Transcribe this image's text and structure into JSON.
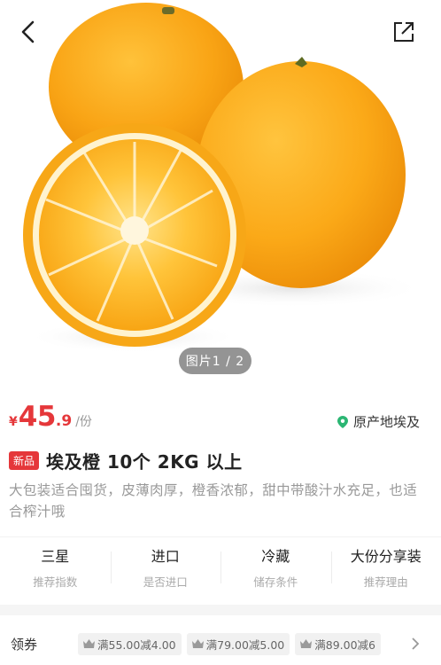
{
  "header": {
    "back_icon": "chevron-left-icon",
    "share_icon": "share-icon"
  },
  "gallery": {
    "counter": "图片1 / 2"
  },
  "price": {
    "symbol": "¥",
    "integer": "45",
    "decimal": ".9",
    "unit": "/份",
    "color": "#e5373a"
  },
  "origin": {
    "label": "原产地埃及",
    "icon": "location-pin-icon",
    "icon_color": "#2bb673"
  },
  "product": {
    "badge": "新品",
    "title": "埃及橙 10个 2KG 以上",
    "description": "大包装适合囤货，皮薄肉厚，橙香浓郁，甜中带酸汁水充足，也适合榨汁哦"
  },
  "attributes": [
    {
      "value": "三星",
      "label": "推荐指数"
    },
    {
      "value": "进口",
      "label": "是否进口"
    },
    {
      "value": "冷藏",
      "label": "储存条件"
    },
    {
      "value": "大份分享装",
      "label": "推荐理由"
    }
  ],
  "coupons": {
    "title": "领券",
    "items": [
      "满55.00减4.00",
      "满79.00减5.00",
      "满89.00减6"
    ]
  }
}
